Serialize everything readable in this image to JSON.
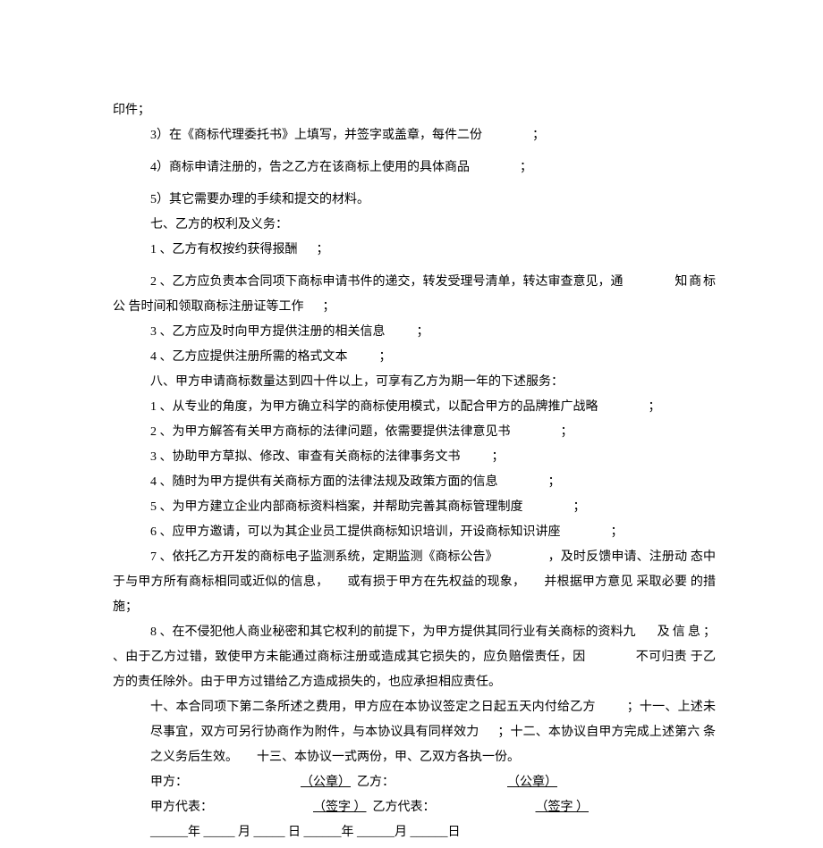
{
  "l0": "印件；",
  "l1a": "3）在《商标代理委托书》上填写，并签字或盖章，每件二份",
  "l1b": "；",
  "l2a": "4）商标申请注册的，告之乙方在该商标上使用的具体商品",
  "l2b": "；",
  "l3": "5）其它需要办理的手续和提交的材料。",
  "l4": "七、乙方的权利及义务：",
  "l5a": "1 、乙方有权按约获得报酬",
  "l5b": "；",
  "l6a": "2 、乙方应负责本合同项下商标申请书件的递交，转发受理号清单，转达审查意见，通",
  "l6b": "知商标公",
  "l7a": "告时间和领取商标注册证等工作",
  "l7b": "；",
  "l8a": "3 、乙方应及时向甲方提供注册的相关信息",
  "l8b": "；",
  "l9a": "4 、乙方应提供注册所需的格式文本",
  "l9b": "；",
  "l10": "八、甲方申请商标数量达到四十件以上，可享有乙方为期一年的下述服务：",
  "l11a": "1 、从专业的角度，为甲方确立科学的商标使用模式，以配合甲方的品牌推广战略",
  "l11b": "；",
  "l12a": "2 、为甲方解答有关甲方商标的法律问题，依需要提供法律意见书",
  "l12b": "；",
  "l13a": "3 、协助甲方草拟、修改、审查有关商标的法律事务文书",
  "l13b": "；",
  "l14a": "4 、随时为甲方提供有关商标方面的法律法规及政策方面的信息",
  "l14b": "；",
  "l15a": "5 、为甲方建立企业内部商标资料档案，并帮助完善其商标管理制度",
  "l15b": "；",
  "l16a": "6 、应甲方邀请，可以为其企业员工提供商标知识培训，开设商标知识讲座",
  "l16b": "；",
  "l17a": "7 、依托乙方开发的商标电子监测系统，定期监测《商标公告》",
  "l17b": "，及时反馈申请、注册动",
  "l18a": "态中于与甲方所有商标相同或近似的信息，",
  "l18b": "或有损于甲方在先权益的现象，",
  "l18c": "并根据甲方意见    采取必要",
  "l19": "的措施；",
  "l20a": "8 、在不侵犯他人商业秘密和其它权利的前提下，为甲方提供其同行业有关商标的资料九",
  "l20b": "及信息；",
  "l21a": "、由于乙方过错，致使甲方未能通过商标注册或造成其它损失的，应负赔偿责任，因",
  "l21b": "不可归责",
  "l22": "于乙方的责任除外。由于甲方过错给乙方造成损失的，也应承担相应责任。",
  "l23a": "十、本合同项下第二条所述之费用，甲方应在本协议签定之日起五天内付给乙方",
  "l23b": "；十一、上述未",
  "l24a": "尽事宜，双方可另行协商作为附件，与本协议具有同样效力",
  "l24b": "；十二、本协议自甲方完成上述第六",
  "l25a": "条之义务后生效。",
  "l25b": "十三、本协议一式两份，甲、乙双方各执一份。",
  "sig1a": "甲方：",
  "sig1b": "（公章）",
  "sig1c": "乙方：",
  "sig1d": "（公章）",
  "sig2a": "甲方代表：",
  "sig2b": "（签字 ）",
  "sig2c": "乙方代表：",
  "sig2d": "（签字 ）",
  "date": "______年  _____ 月  _____ 日  ______年  ______月 ______日"
}
